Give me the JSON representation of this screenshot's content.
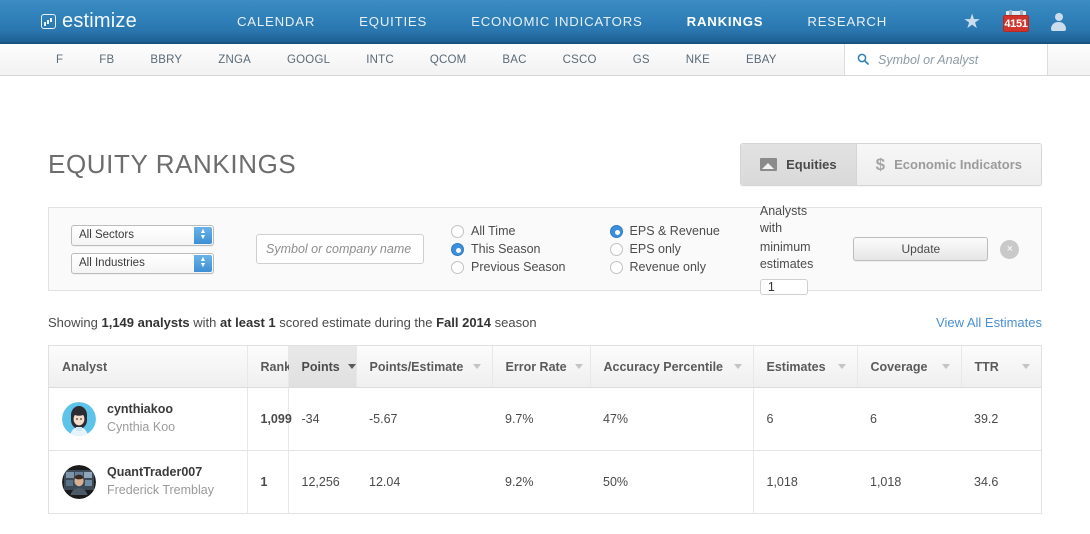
{
  "nav": {
    "brand": "estimize",
    "brand_icon": "chart-square-icon",
    "links": [
      {
        "label": "CALENDAR",
        "active": false
      },
      {
        "label": "EQUITIES",
        "active": false
      },
      {
        "label": "ECONOMIC INDICATORS",
        "active": false
      },
      {
        "label": "RANKINGS",
        "active": true
      },
      {
        "label": "RESEARCH",
        "active": false
      }
    ],
    "star_icon": "★",
    "calendar_badge": "4151",
    "user_icon": "user-avatar-icon"
  },
  "ticker_bar": {
    "symbols": [
      "F",
      "FB",
      "BBRY",
      "ZNGA",
      "GOOGL",
      "INTC",
      "QCOM",
      "BAC",
      "CSCO",
      "GS",
      "NKE",
      "EBAY"
    ],
    "search": {
      "icon": "🔍",
      "placeholder": "Symbol or Analyst",
      "value": ""
    }
  },
  "page": {
    "title": "EQUITY RANKINGS",
    "segments": [
      {
        "label": "Equities",
        "icon": "chart-icon",
        "active": true
      },
      {
        "label": "Economic Indicators",
        "icon": "dollar-icon",
        "active": false
      }
    ]
  },
  "filters": {
    "sector_select": {
      "value": "All Sectors"
    },
    "industry_select": {
      "value": "All Industries"
    },
    "symbol_input": {
      "placeholder": "Symbol or company name",
      "value": ""
    },
    "period_radios": [
      {
        "label": "All Time",
        "selected": false
      },
      {
        "label": "This Season",
        "selected": true
      },
      {
        "label": "Previous Season",
        "selected": false
      }
    ],
    "metric_radios": [
      {
        "label": "EPS & Revenue",
        "selected": true
      },
      {
        "label": "EPS only",
        "selected": false
      },
      {
        "label": "Revenue only",
        "selected": false
      }
    ],
    "min_estimates": {
      "label_line1": "Analysts with",
      "label_line2": "minimum estimates",
      "value": "1"
    },
    "update_button": "Update",
    "clear_button": "×"
  },
  "results": {
    "showing_prefix": "Showing ",
    "showing_count": "1,149 analysts",
    "showing_mid": " with ",
    "showing_min": "at least 1",
    "showing_mid2": " scored estimate during the ",
    "showing_season": "Fall 2014",
    "showing_suffix": " season",
    "view_all_link": "View All Estimates"
  },
  "table": {
    "columns": [
      {
        "label": "Analyst",
        "sorted": false,
        "caret": false
      },
      {
        "label": "Rank",
        "sorted": false,
        "caret": false
      },
      {
        "label": "Points",
        "sorted": true,
        "caret": true
      },
      {
        "label": "Points/Estimate",
        "sorted": false,
        "caret": true
      },
      {
        "label": "Error Rate",
        "sorted": false,
        "caret": true
      },
      {
        "label": "Accuracy Percentile",
        "sorted": false,
        "caret": true
      },
      {
        "label": "Estimates",
        "sorted": false,
        "caret": true
      },
      {
        "label": "Coverage",
        "sorted": false,
        "caret": true
      },
      {
        "label": "TTR",
        "sorted": false,
        "caret": true
      }
    ],
    "rows": [
      {
        "handle": "cynthiakoo",
        "name": "Cynthia Koo",
        "avatar": "female-cartoon-avatar",
        "rank": "1,099",
        "points": "-34",
        "points_per_estimate": "-5.67",
        "error_rate": "9.7%",
        "accuracy_percentile": "47%",
        "estimates": "6",
        "coverage": "6",
        "ttr": "39.2"
      },
      {
        "handle": "QuantTrader007",
        "name": "Frederick Tremblay",
        "avatar": "male-photo-avatar",
        "rank": "1",
        "points": "12,256",
        "points_per_estimate": "12.04",
        "error_rate": "9.2%",
        "accuracy_percentile": "50%",
        "estimates": "1,018",
        "coverage": "1,018",
        "ttr": "34.6"
      }
    ]
  },
  "colors": {
    "nav_blue": "#2f7fb8",
    "accent_blue": "#3b8fdd",
    "link_blue": "#4b8fd0",
    "badge_red": "#d0342c"
  }
}
